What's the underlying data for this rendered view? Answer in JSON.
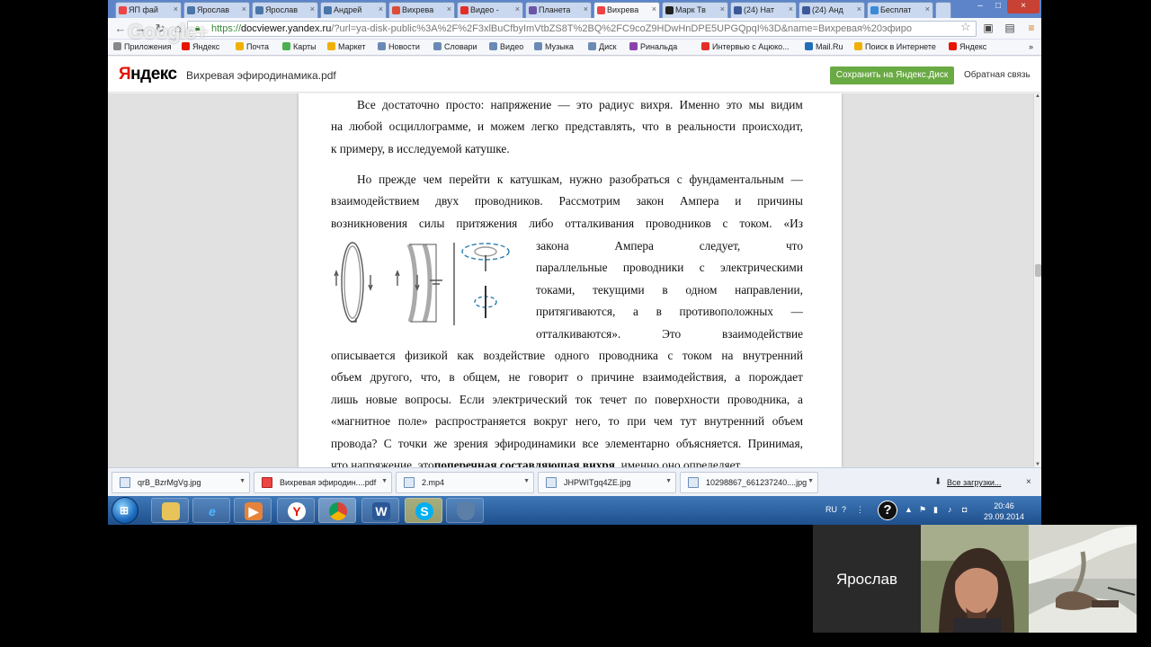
{
  "browser": {
    "tabs": [
      {
        "label": "ЯП фай",
        "color": "#e44"
      },
      {
        "label": "Ярослав",
        "color": "#4a76a8"
      },
      {
        "label": "Ярослав",
        "color": "#4a76a8"
      },
      {
        "label": "Андрей",
        "color": "#4a76a8"
      },
      {
        "label": "Вихрева",
        "color": "#dd4b39"
      },
      {
        "label": "Видео -",
        "color": "#e52d27"
      },
      {
        "label": "Планета",
        "color": "#6a55a8"
      },
      {
        "label": "Вихрева",
        "color": "#e44"
      },
      {
        "label": "Марк Тв",
        "color": "#222"
      },
      {
        "label": "(24) Нат",
        "color": "#3b5998"
      },
      {
        "label": "(24) Анд",
        "color": "#3b5998"
      },
      {
        "label": "Бесплат",
        "color": "#3a8ad8"
      }
    ],
    "url_scheme": "https://",
    "url_host": "docviewer.yandex.ru",
    "url_path": "/?url=ya-disk-public%3A%2F%2F3xlBuCfbyImVtbZS8T%2BQ%2FC9coZ9HDwHnDPE5UPGQpqI%3D&name=Вихревая%20эфиро",
    "bookmarks": [
      {
        "label": "Приложения",
        "color": "#888"
      },
      {
        "label": "Яндекс",
        "color": "#e61400"
      },
      {
        "label": "Почта",
        "color": "#f0b000"
      },
      {
        "label": "Карты",
        "color": "#4caf50"
      },
      {
        "label": "Маркет",
        "color": "#f0b000"
      },
      {
        "label": "Новости",
        "color": "#6a8ab5"
      },
      {
        "label": "Словари",
        "color": "#6a8ab5"
      },
      {
        "label": "Видео",
        "color": "#6a8ab5"
      },
      {
        "label": "Музыка",
        "color": "#6a8ab5"
      },
      {
        "label": "Диск",
        "color": "#6a8ab5"
      },
      {
        "label": "Ринальда",
        "color": "#8844aa"
      },
      {
        "label": "Интервью с Ацюко...",
        "color": "#e52d27"
      },
      {
        "label": "Mail.Ru",
        "color": "#1f6fb8"
      },
      {
        "label": "Поиск в Интернете",
        "color": "#f0b000"
      },
      {
        "label": "Яндекс",
        "color": "#e61400"
      }
    ],
    "more_bookmarks": "»",
    "gplus_logo": "Google+"
  },
  "yandex": {
    "logo_ya": "Я",
    "logo_rest": "ндекс",
    "doc_title": "Вихревая эфиродинамика.pdf",
    "save_button": "Сохранить на Яндекс.Диск",
    "feedback": "Обратная связь"
  },
  "document": {
    "para1": [
      "Все достаточно просто: напряжение — это радиус вихря. Именно это мы видим",
      "на любой осциллограмме, и можем легко представлять, что в реальности происходит,",
      "к примеру, в исследуемой катушке."
    ],
    "para2": [
      "Но прежде чем перейти к катушкам, нужно разобраться с фундаментальным —",
      "взаимодействием двух проводников. Рассмотрим закон Ампера и причины",
      "возникновения силы притяжения либо отталкивания проводников с током. «Из"
    ],
    "wrap": [
      "закона Ампера следует, что",
      "параллельные проводники с электрическими",
      "токами, текущими в одном направлении,",
      "притягиваются, а в противоположных —",
      "отталкиваются». Это взаимодействие"
    ],
    "para3": [
      "описывается физикой как воздействие одного проводника с током на внутренний",
      "объем другого, что, в общем, не говорит о причине взаимодействия, а порождает",
      "лишь новые вопросы. Если электрический ток течет по поверхности проводника, а",
      "«магнитное поле» распространяется вокруг него, то при чем тут внутренний объем",
      "провода? С точки же зрения эфиродинамики все элементарно объясняется. Принимая,"
    ],
    "cut_line_start": "что напряжение, это ",
    "cut_line_bold": "поперечная составляющая вихря",
    "cut_line_end": ", именно оно определяет"
  },
  "downloads": {
    "items": [
      "qrB_BzrMgVg.jpg",
      "Вихревая эфиродин....pdf",
      "2.mp4",
      "JHPWITgq4ZE.jpg",
      "10298867_661237240....jpg"
    ],
    "all_label": "Все загрузки..."
  },
  "taskbar": {
    "lang": "RU",
    "time": "20:46",
    "date": "29.09.2014"
  },
  "hangout": {
    "participant_name": "Ярослав"
  },
  "colors": {
    "save_green": "#6aaa44",
    "yandex_red": "#e61400",
    "taskbar_blue": "#2a5f9e"
  }
}
